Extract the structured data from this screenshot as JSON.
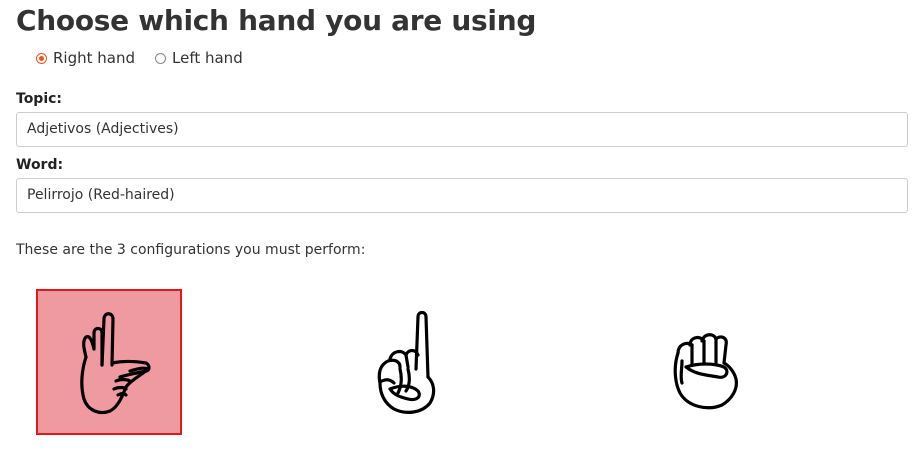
{
  "title": "Choose which hand you are using",
  "hand_options": [
    {
      "label": "Right hand",
      "checked": true
    },
    {
      "label": "Left hand",
      "checked": false
    }
  ],
  "topic": {
    "label": "Topic:",
    "value": "Adjetivos (Adjectives)"
  },
  "word": {
    "label": "Word:",
    "value": "Pelirrojo (Red-haired)"
  },
  "instructions": "These are the 3 configurations you must perform:",
  "configurations": [
    {
      "icon": "hand-l-shape-icon",
      "active": true
    },
    {
      "icon": "hand-index-up-icon",
      "active": false
    },
    {
      "icon": "hand-fist-icon",
      "active": false
    }
  ],
  "colors": {
    "accent": "#e95420",
    "active_bg": "#ef9aa0",
    "active_border": "#e0181e"
  }
}
